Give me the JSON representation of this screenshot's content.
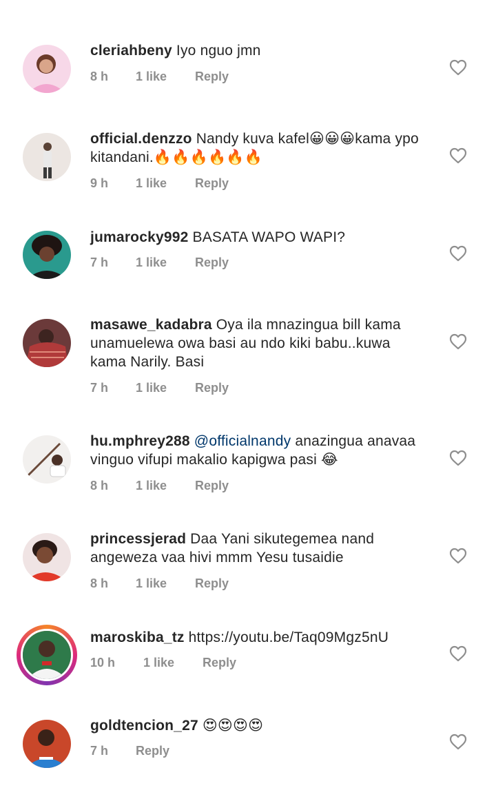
{
  "comments": [
    {
      "username": "cleriahbeny",
      "text": "Iyo nguo jmn",
      "time": "8 h",
      "likes": "1 like",
      "reply": "Reply"
    },
    {
      "username": "official.denzzo",
      "text": "Nandy kuva kafel😀😀😀kama ypo kitandani.🔥🔥🔥🔥🔥🔥",
      "time": "9 h",
      "likes": "1 like",
      "reply": "Reply"
    },
    {
      "username": "jumarocky992",
      "text": "BASATA WAPO WAPI?",
      "time": "7 h",
      "likes": "1 like",
      "reply": "Reply"
    },
    {
      "username": "masawe_kadabra",
      "text": "Oya ila mnazingua bill kama unamuelewa owa basi au ndo kiki babu..kuwa kama Narily. Basi",
      "time": "7 h",
      "likes": "1 like",
      "reply": "Reply"
    },
    {
      "username": "hu.mphrey288",
      "mention": "@officialnandy",
      "text": " anazingua anavaa vinguo vifupi makalio kapigwa pasi 😂",
      "time": "8 h",
      "likes": "1 like",
      "reply": "Reply"
    },
    {
      "username": "princessjerad",
      "text": "Daa Yani sikutegemea nand angeweza vaa hivi mmm Yesu tusaidie",
      "time": "8 h",
      "likes": "1 like",
      "reply": "Reply"
    },
    {
      "username": "maroskiba_tz",
      "text": "https://youtu.be/Taq09Mgz5nU",
      "time": "10 h",
      "likes": "1 like",
      "reply": "Reply"
    },
    {
      "username": "goldtencion_27",
      "text": "😍😍😍😍",
      "time": "7 h",
      "likes": "",
      "reply": "Reply"
    }
  ],
  "colors": {
    "text": "#262626",
    "meta": "#8e8e8e",
    "mention": "#00376b",
    "heart": "#8e8e8e"
  },
  "icons": {
    "like": "heart-outline-icon",
    "avatar": "profile-photo"
  }
}
